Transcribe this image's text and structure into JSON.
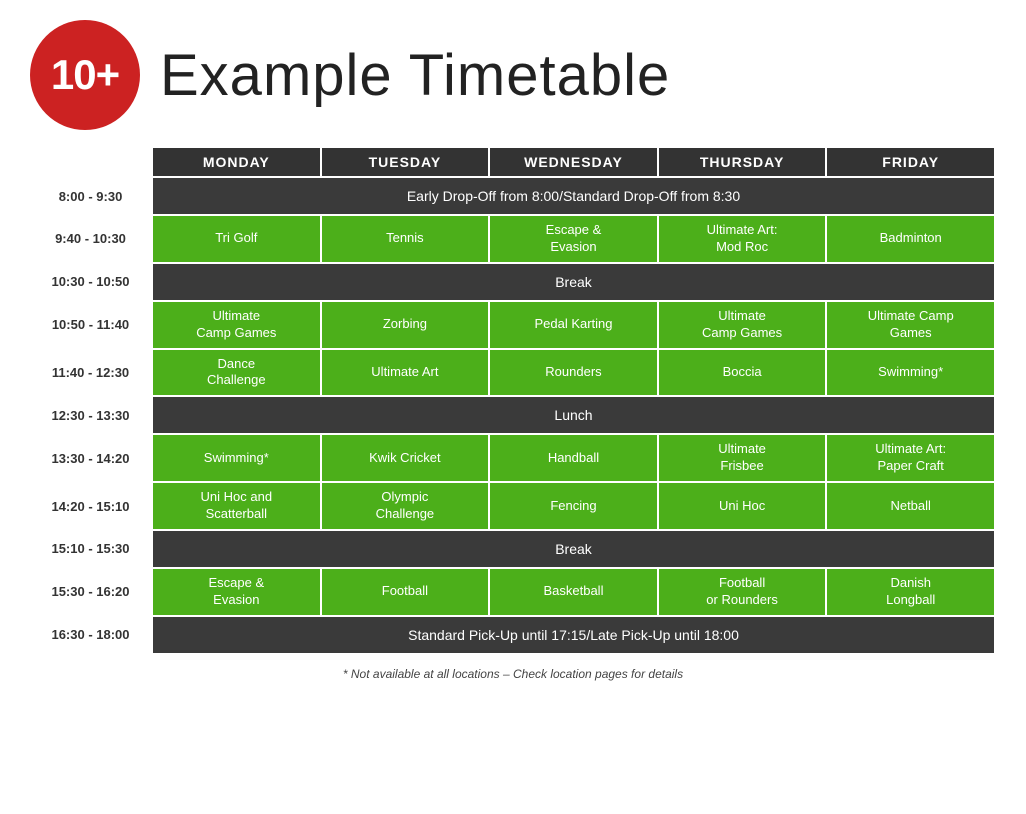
{
  "header": {
    "badge": "10+",
    "title": "Example Timetable"
  },
  "columns": [
    "MONDAY",
    "TUESDAY",
    "WEDNESDAY",
    "THURSDAY",
    "FRIDAY"
  ],
  "rows": [
    {
      "time": "",
      "type": "header"
    },
    {
      "time": "8:00 - 9:30",
      "type": "span",
      "text": "Early Drop-Off from 8:00/Standard Drop-Off from 8:30"
    },
    {
      "time": "9:40 - 10:30",
      "type": "activities",
      "cells": [
        "Tri Golf",
        "Tennis",
        "Escape &\nEvasion",
        "Ultimate Art:\nMod Roc",
        "Badminton"
      ]
    },
    {
      "time": "10:30 - 10:50",
      "type": "span",
      "text": "Break"
    },
    {
      "time": "10:50 - 11:40",
      "type": "activities",
      "cells": [
        "Ultimate\nCamp Games",
        "Zorbing",
        "Pedal Karting",
        "Ultimate\nCamp Games",
        "Ultimate Camp\nGames"
      ]
    },
    {
      "time": "11:40 - 12:30",
      "type": "activities",
      "cells": [
        "Dance\nChallenge",
        "Ultimate Art",
        "Rounders",
        "Boccia",
        "Swimming*"
      ]
    },
    {
      "time": "12:30 - 13:30",
      "type": "span",
      "text": "Lunch"
    },
    {
      "time": "13:30 - 14:20",
      "type": "activities",
      "cells": [
        "Swimming*",
        "Kwik Cricket",
        "Handball",
        "Ultimate\nFrisbee",
        "Ultimate Art:\nPaper Craft"
      ]
    },
    {
      "time": "14:20 - 15:10",
      "type": "activities",
      "cells": [
        "Uni Hoc and\nScatterball",
        "Olympic\nChallenge",
        "Fencing",
        "Uni Hoc",
        "Netball"
      ]
    },
    {
      "time": "15:10 - 15:30",
      "type": "span",
      "text": "Break"
    },
    {
      "time": "15:30 - 16:20",
      "type": "activities",
      "cells": [
        "Escape &\nEvasion",
        "Football",
        "Basketball",
        "Football\nor Rounders",
        "Danish\nLongball"
      ]
    },
    {
      "time": "16:30 - 18:00",
      "type": "span",
      "text": "Standard Pick-Up until 17:15/Late Pick-Up until 18:00"
    }
  ],
  "footnote": "* Not available at all locations – Check location pages for details"
}
